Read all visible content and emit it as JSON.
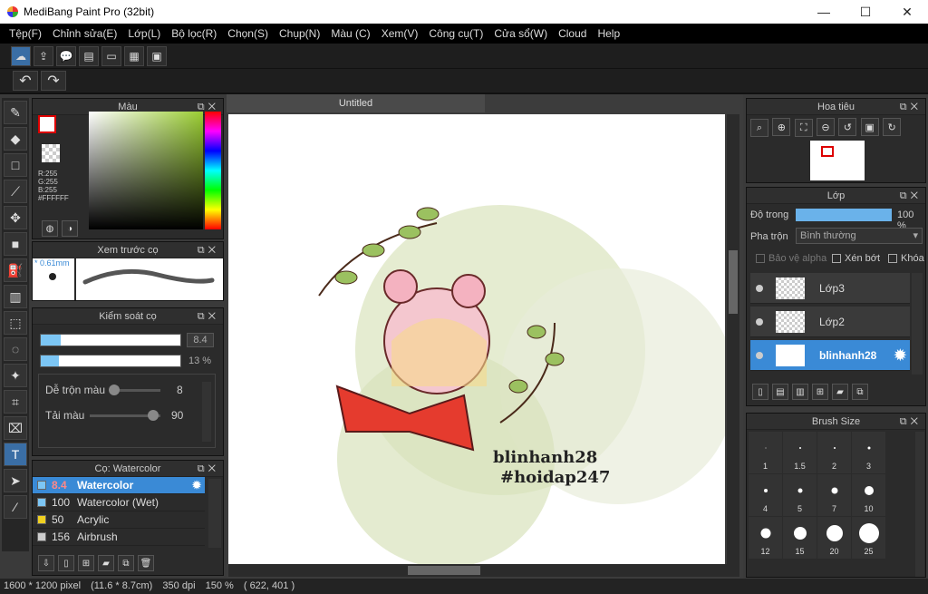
{
  "window": {
    "title": "MediBang Paint Pro (32bit)",
    "minimize": "—",
    "maximize": "☐",
    "close": "✕"
  },
  "menu": [
    "Tệp(F)",
    "Chỉnh sửa(E)",
    "Lớp(L)",
    "Bộ lọc(R)",
    "Chọn(S)",
    "Chụp(N)",
    "Màu (C)",
    "Xem(V)",
    "Công cụ(T)",
    "Cửa sổ(W)",
    "Cloud",
    "Help"
  ],
  "toolbar": {
    "undo": "↶",
    "redo": "↷"
  },
  "color_panel": {
    "title": "Màu",
    "r": "R:255",
    "g": "G:255",
    "b": "B:255",
    "hex": "#FFFFFF",
    "fg": "#FFFFFF"
  },
  "brush_preview": {
    "title": "Xem trước cọ",
    "size": "* 0.61mm"
  },
  "brush_control": {
    "title": "Kiểm soát cọ",
    "size_value": "8.4",
    "size_fraction": 0.14,
    "opacity_value": "13 %",
    "opacity_fraction": 0.13,
    "blend_label": "Dễ trộn màu",
    "blend_value": "8",
    "blend_fraction": 0.09,
    "reload_label": "Tải màu",
    "reload_value": "90",
    "reload_fraction": 0.9
  },
  "brush_list": {
    "title": "Cọ: Watercolor",
    "items": [
      {
        "size": "8.4",
        "name": "Watercolor",
        "color": "#7cc6f5",
        "active": true
      },
      {
        "size": "100",
        "name": "Watercolor (Wet)",
        "color": "#7cc6f5",
        "active": false
      },
      {
        "size": "50",
        "name": "Acrylic",
        "color": "#f0d020",
        "active": false
      },
      {
        "size": "156",
        "name": "Airbrush",
        "color": "#cccccc",
        "active": false
      }
    ]
  },
  "document": {
    "tab": "Untitled"
  },
  "artwork": {
    "line1": "blinhanh28",
    "line2": "#hoidap247"
  },
  "navigator": {
    "title": "Hoa tiêu"
  },
  "layer_panel": {
    "title": "Lớp",
    "opacity_label": "Độ trong",
    "opacity_value": "100 %",
    "opacity_fraction": 1.0,
    "blend_label": "Pha trộn",
    "blend_value": "Bình thường",
    "protect_alpha": "Bảo vệ alpha",
    "clipping": "Xén bớt",
    "lock": "Khóa",
    "layers": [
      {
        "name": "Lớp3",
        "active": false
      },
      {
        "name": "Lớp2",
        "active": false
      },
      {
        "name": "blinhanh28",
        "active": true
      }
    ]
  },
  "brush_size": {
    "title": "Brush Size",
    "sizes": [
      "1",
      "1.5",
      "2",
      "3",
      "4",
      "5",
      "7",
      "10",
      "12",
      "15",
      "20",
      "25"
    ]
  },
  "status": {
    "dimensions": "1600 * 1200 pixel",
    "physical": "(11.6 * 8.7cm)",
    "dpi": "350 dpi",
    "zoom": "150 %",
    "cursor": "( 622, 401 )"
  }
}
